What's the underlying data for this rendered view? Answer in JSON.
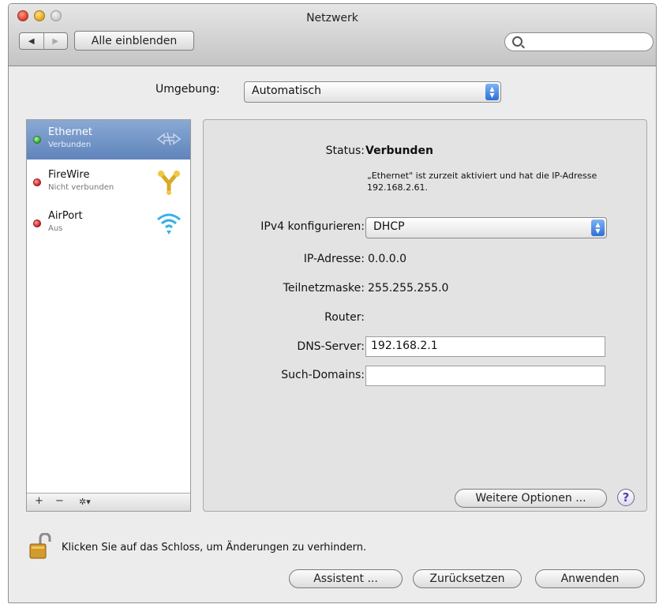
{
  "window": {
    "title": "Netzwerk"
  },
  "toolbar": {
    "back": "◀",
    "forward": "▶",
    "show_all": "Alle einblenden"
  },
  "location": {
    "label": "Umgebung:",
    "value": "Automatisch"
  },
  "services": [
    {
      "name": "Ethernet",
      "status": "Verbunden",
      "icon": "ethernet-icon",
      "color": "#2ea92b"
    },
    {
      "name": "FireWire",
      "status": "Nicht verbunden",
      "icon": "firewire-icon",
      "color": "#d21e22"
    },
    {
      "name": "AirPort",
      "status": "Aus",
      "icon": "airport-wifi-icon",
      "color": "#d21e22"
    }
  ],
  "sidebar_bar": {
    "add": "+",
    "remove": "−",
    "action": "✲▾"
  },
  "detail": {
    "status_label": "Status:",
    "status_value": "Verbunden",
    "status_note": "„Ethernet\" ist zurzeit aktiviert und hat die IP-Adresse 192.168.2.61.",
    "ipv4_label": "IPv4 konfigurieren:",
    "ipv4_value": "DHCP",
    "ip_label": "IP-Adresse:",
    "ip_value": "0.0.0.0",
    "subnet_label": "Teilnetzmaske:",
    "subnet_value": "255.255.255.0",
    "router_label": "Router:",
    "router_value": "",
    "dns_label": "DNS-Server:",
    "dns_value": "192.168.2.1",
    "search_label": "Such-Domains:",
    "search_value": "",
    "advanced_button": "Weitere Optionen ...",
    "help": "?"
  },
  "footer": {
    "lock_text": "Klicken Sie auf das Schloss, um Änderungen zu verhindern.",
    "assistant": "Assistent ...",
    "revert": "Zurücksetzen",
    "apply": "Anwenden"
  }
}
